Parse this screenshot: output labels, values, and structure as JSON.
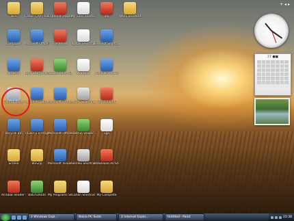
{
  "desktop": {
    "icons": [
      {
        "label": "Jace",
        "color": "folder",
        "col": 0,
        "row": 0
      },
      {
        "label": "Canon CAPT Tools",
        "color": "folder",
        "col": 1,
        "row": 0
      },
      {
        "label": "Cyberlink PowerDVD",
        "color": "red",
        "col": 2,
        "row": 0
      },
      {
        "label": "My Sims Shortcut",
        "color": "doc",
        "col": 3,
        "row": 0
      },
      {
        "label": "Shi",
        "color": "red",
        "col": 4,
        "row": 0
      },
      {
        "label": "WAVE Shortcut",
        "color": "folder",
        "col": 5,
        "row": 0
      },
      {
        "label": "Computer",
        "color": "blue",
        "col": 0,
        "row": 1
      },
      {
        "label": "Microsoft Office Pi...",
        "color": "blue",
        "col": 1,
        "row": 1
      },
      {
        "label": "Flashbook",
        "color": "red",
        "col": 2,
        "row": 1
      },
      {
        "label": "Kodak Shortcut",
        "color": "doc",
        "col": 3,
        "row": 1
      },
      {
        "label": "FireShot Shortcut",
        "color": "blue",
        "col": 4,
        "row": 1
      },
      {
        "label": "Network",
        "color": "blue",
        "col": 0,
        "row": 2
      },
      {
        "label": "Nero StartSmart",
        "color": "red",
        "col": 1,
        "row": 2
      },
      {
        "label": "AdobeReader Shortcut",
        "color": "green",
        "col": 2,
        "row": 2
      },
      {
        "label": "Wordpad",
        "color": "doc",
        "col": 3,
        "row": 2
      },
      {
        "label": "Windows Movie Maker",
        "color": "blue",
        "col": 4,
        "row": 2
      },
      {
        "label": "Control Panel",
        "color": "gray",
        "col": 0,
        "row": 3,
        "selected": true
      },
      {
        "label": "Nokia PC Suite",
        "color": "blue",
        "col": 1,
        "row": 3
      },
      {
        "label": "Microsoft FrontPage",
        "color": "blue",
        "col": 2,
        "row": 3
      },
      {
        "label": "MS PC Scanning",
        "color": "gray",
        "col": 3,
        "row": 3
      },
      {
        "label": "Samsung PC",
        "color": "red",
        "col": 4,
        "row": 3
      },
      {
        "label": "Recycle Bin",
        "color": "blue",
        "col": 0,
        "row": 4
      },
      {
        "label": "ThDict 2.0 Program",
        "color": "blue",
        "col": 1,
        "row": 4
      },
      {
        "label": "Microsoft Office Pi...",
        "color": "blue",
        "col": 2,
        "row": 4
      },
      {
        "label": "Radmin Viewer 3.0",
        "color": "green",
        "col": 3,
        "row": 4
      },
      {
        "label": "vga",
        "color": "doc",
        "col": 4,
        "row": 4
      },
      {
        "label": "Screen",
        "color": "folder",
        "col": 0,
        "row": 5
      },
      {
        "label": "WinZip",
        "color": "folder",
        "col": 1,
        "row": 5
      },
      {
        "label": "Microsoft Visual Basic",
        "color": "blue",
        "col": 2,
        "row": 5
      },
      {
        "label": "Skrillex Shortcut",
        "color": "gray",
        "col": 3,
        "row": 5
      },
      {
        "label": "Download All Shortcut",
        "color": "red",
        "col": 4,
        "row": 5
      },
      {
        "label": "Acrobat Reader 5.0",
        "color": "red",
        "col": 0,
        "row": 6
      },
      {
        "label": "BatchUtil00",
        "color": "green",
        "col": 1,
        "row": 6
      },
      {
        "label": "My Programs Shortcut",
        "color": "folder",
        "col": 2,
        "row": 6
      },
      {
        "label": "Canon Shortcut",
        "color": "doc",
        "col": 3,
        "row": 6
      },
      {
        "label": "My Complete",
        "color": "folder",
        "col": 4,
        "row": 6
      }
    ]
  },
  "sidebar": {
    "controls": "+ ◂ ▸",
    "calendar_header": "27 ■■"
  },
  "taskbar": {
    "buttons": [
      "2 Windows Expl...",
      "Nokia PC Suite",
      "2 Internet Explo...",
      "Untitled - Paint"
    ],
    "time": "22:38"
  }
}
